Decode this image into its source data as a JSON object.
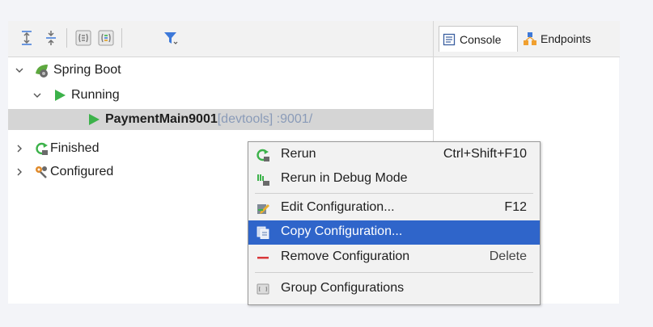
{
  "toolbar": {
    "icons": [
      "expand-all-icon",
      "collapse-all-icon",
      "group-by-type-icon",
      "group-by-status-icon",
      "filter-icon"
    ]
  },
  "tabs": [
    {
      "label": "Console",
      "icon": "console-icon",
      "active": true
    },
    {
      "label": "Endpoints",
      "icon": "endpoints-icon",
      "active": false
    }
  ],
  "tree": {
    "root": {
      "label": "Spring Boot"
    },
    "running": {
      "label": "Running"
    },
    "app": {
      "label": "PaymentMain9001",
      "suffix": " [devtools] :9001/"
    },
    "finished": {
      "label": "Finished"
    },
    "configured": {
      "label": "Configured"
    }
  },
  "menu": {
    "items": [
      {
        "label": "Rerun",
        "shortcut": "Ctrl+Shift+F10",
        "icon": "rerun-icon"
      },
      {
        "label": "Rerun in Debug Mode",
        "shortcut": "",
        "icon": "debug-icon"
      },
      {
        "label": "Edit Configuration...",
        "shortcut": "F12",
        "icon": "edit-config-icon"
      },
      {
        "label": "Copy Configuration...",
        "shortcut": "",
        "icon": "copy-config-icon",
        "highlighted": true
      },
      {
        "label": "Remove Configuration",
        "shortcut": "Delete",
        "icon": "remove-icon"
      },
      {
        "label": "Group Configurations",
        "shortcut": "",
        "icon": "folder-icon"
      }
    ]
  },
  "colors": {
    "selection": "#2f65ca",
    "running_green": "#3cb24a",
    "remove_red": "#d9383a"
  }
}
